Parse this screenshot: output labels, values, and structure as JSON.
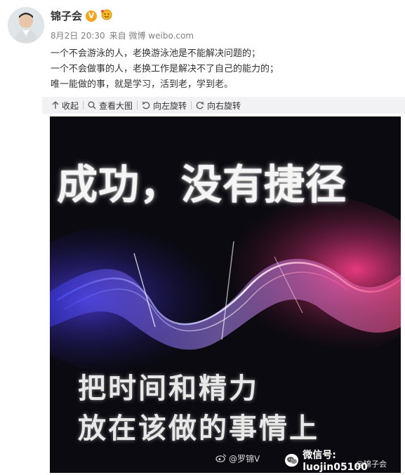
{
  "post": {
    "author": "锦子会",
    "verified_badge": "V",
    "date": "8月2日 20:30",
    "source": "来自 微博 weibo.com",
    "lines": [
      "一个不会游泳的人，老换游泳池是不能解决问题的；",
      "一个不会做事的人，老换工作是解决不了自己的能力的；",
      "唯一能做的事，就是学习，活到老，学到老。"
    ]
  },
  "toolbar": {
    "collapse": "收起",
    "view_large": "查看大图",
    "rotate_left": "向左旋转",
    "rotate_right": "向右旋转"
  },
  "image": {
    "headline": "成功，没有捷径",
    "subline_1": "把时间和精力",
    "subline_2": "放在该做的事情上",
    "weibo_watermark": "@罗锦V",
    "wechat_watermark": "微信号: luojin05100",
    "handle_watermark": "@锦子会"
  },
  "colors": {
    "badge": "#f7a31c",
    "toolbar_bg": "#f2f2f5",
    "meta_text": "#808080"
  },
  "icons": [
    "avatar",
    "verified-badge-icon",
    "emoji-badge-icon",
    "collapse-icon",
    "magnifier-icon",
    "rotate-left-icon",
    "rotate-right-icon",
    "weibo-logo-icon",
    "wechat-logo-icon"
  ]
}
